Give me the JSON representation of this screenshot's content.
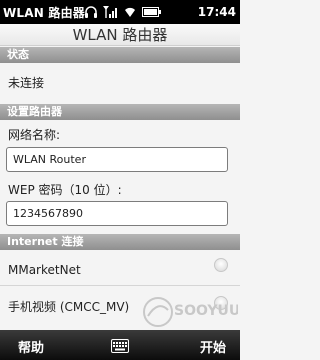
{
  "status_bar": {
    "title": "WLAN 路由器",
    "time": "17:44",
    "icons": [
      "headset-icon",
      "signal-icon",
      "wifi-icon",
      "battery-icon"
    ]
  },
  "page_title": "WLAN 路由器",
  "section_status": {
    "header": "状态",
    "value": "未连接"
  },
  "section_router": {
    "header": "设置路由器",
    "network_name_label": "网络名称:",
    "network_name_value": "WLAN Router",
    "wep_label": "WEP 密码（10 位）:",
    "wep_value": "1234567890"
  },
  "section_internet": {
    "header": "Internet 连接",
    "options": [
      {
        "label": "MMarketNet",
        "selected": false
      },
      {
        "label": "手机视频 (CMCC_MV)",
        "selected": false
      }
    ]
  },
  "bottom_bar": {
    "left_label": "帮助",
    "right_label": "开始",
    "center_icon": "keyboard-icon"
  },
  "watermark": "SOOYUU",
  "colors": {
    "status_bar_bg": "#000000",
    "section_header_bg": "#9e9e9e",
    "bottom_bar_bg": "#1a1a1a"
  }
}
